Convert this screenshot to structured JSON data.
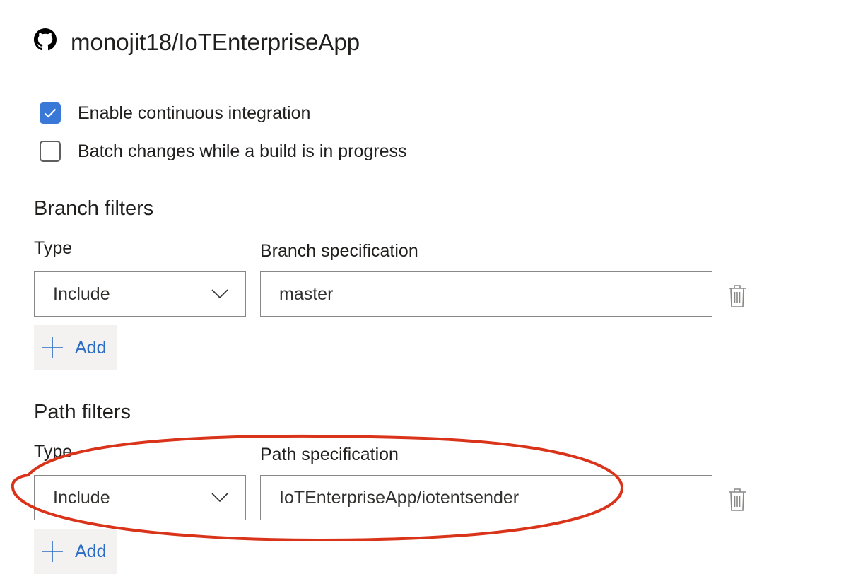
{
  "repo": {
    "icon": "github-icon",
    "name": "monojit18/IoTEnterpriseApp"
  },
  "options": [
    {
      "label": "Enable continuous integration",
      "checked": true
    },
    {
      "label": "Batch changes while a build is in progress",
      "checked": false
    }
  ],
  "branch_filters": {
    "title": "Branch filters",
    "type_label": "Type",
    "spec_label": "Branch specification",
    "type_value": "Include",
    "spec_value": "master",
    "add_label": "Add"
  },
  "path_filters": {
    "title": "Path filters",
    "type_label": "Type",
    "spec_label": "Path specification",
    "type_value": "Include",
    "spec_value": "IoTEnterpriseApp/iotentsender",
    "add_label": "Add"
  },
  "colors": {
    "accent": "#3a78d8",
    "link": "#2b6cc4",
    "annotation": "#d9341a"
  }
}
